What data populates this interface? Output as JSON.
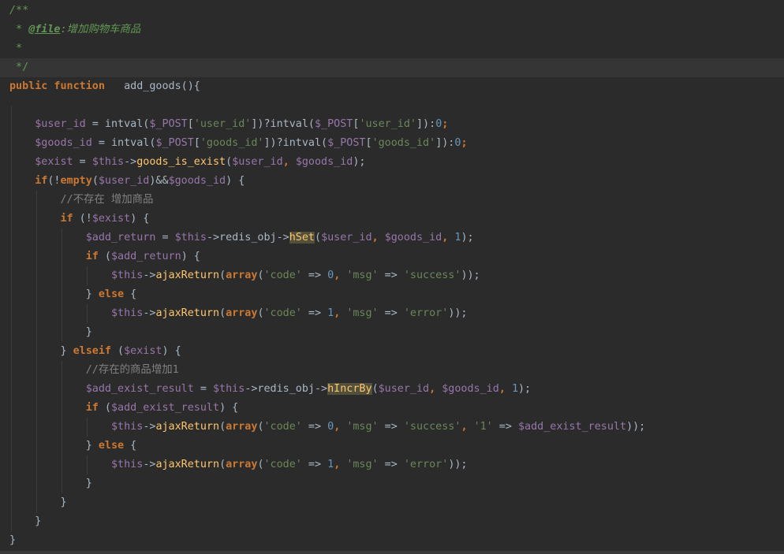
{
  "editor": {
    "lines": [
      [
        {
          "t": "/**",
          "c": "tk-comment"
        }
      ],
      [
        {
          "t": " * ",
          "c": "tk-docstar"
        },
        {
          "t": "@file",
          "c": "tk-doctag"
        },
        {
          "t": ":增加购物车商品",
          "c": "tk-comment"
        }
      ],
      [
        {
          "t": " *",
          "c": "tk-docstar"
        }
      ],
      [
        {
          "t": " */",
          "c": "tk-docstar"
        }
      ],
      [
        {
          "t": "public function",
          "c": "tk-keyword"
        },
        {
          "t": "   add_goods(){",
          "c": "tk-plain"
        }
      ],
      [],
      [
        {
          "t": "    ",
          "c": "tk-plain"
        },
        {
          "t": "$user_id",
          "c": "tk-var"
        },
        {
          "t": " = intval(",
          "c": "tk-plain"
        },
        {
          "t": "$_POST",
          "c": "tk-var"
        },
        {
          "t": "[",
          "c": "tk-plain"
        },
        {
          "t": "'user_id'",
          "c": "tk-string"
        },
        {
          "t": "])?intval(",
          "c": "tk-plain"
        },
        {
          "t": "$_POST",
          "c": "tk-var"
        },
        {
          "t": "[",
          "c": "tk-plain"
        },
        {
          "t": "'user_id'",
          "c": "tk-string"
        },
        {
          "t": "]):",
          "c": "tk-plain"
        },
        {
          "t": "0",
          "c": "tk-number"
        },
        {
          "t": ";",
          "c": "tk-keyword"
        }
      ],
      [
        {
          "t": "    ",
          "c": "tk-plain"
        },
        {
          "t": "$goods_id",
          "c": "tk-var"
        },
        {
          "t": " = intval(",
          "c": "tk-plain"
        },
        {
          "t": "$_POST",
          "c": "tk-var"
        },
        {
          "t": "[",
          "c": "tk-plain"
        },
        {
          "t": "'goods_id'",
          "c": "tk-string"
        },
        {
          "t": "])?intval(",
          "c": "tk-plain"
        },
        {
          "t": "$_POST",
          "c": "tk-var"
        },
        {
          "t": "[",
          "c": "tk-plain"
        },
        {
          "t": "'goods_id'",
          "c": "tk-string"
        },
        {
          "t": "]):",
          "c": "tk-plain"
        },
        {
          "t": "0",
          "c": "tk-number"
        },
        {
          "t": ";",
          "c": "tk-keyword"
        }
      ],
      [
        {
          "t": "    ",
          "c": "tk-plain"
        },
        {
          "t": "$exist",
          "c": "tk-var"
        },
        {
          "t": " = ",
          "c": "tk-plain"
        },
        {
          "t": "$this",
          "c": "tk-var"
        },
        {
          "t": "->",
          "c": "tk-plain"
        },
        {
          "t": "goods_is_exist",
          "c": "tk-fn"
        },
        {
          "t": "(",
          "c": "tk-plain"
        },
        {
          "t": "$user_id",
          "c": "tk-var"
        },
        {
          "t": ", ",
          "c": "tk-keyword"
        },
        {
          "t": "$goods_id",
          "c": "tk-var"
        },
        {
          "t": ");",
          "c": "tk-plain"
        }
      ],
      [
        {
          "t": "    ",
          "c": "tk-plain"
        },
        {
          "t": "if",
          "c": "tk-keyword"
        },
        {
          "t": "(!",
          "c": "tk-plain"
        },
        {
          "t": "empty",
          "c": "tk-keyword"
        },
        {
          "t": "(",
          "c": "tk-plain"
        },
        {
          "t": "$user_id",
          "c": "tk-var"
        },
        {
          "t": ")&&",
          "c": "tk-plain"
        },
        {
          "t": "$goods_id",
          "c": "tk-var"
        },
        {
          "t": ") {",
          "c": "tk-plain"
        }
      ],
      [
        {
          "t": "        ",
          "c": "tk-plain"
        },
        {
          "t": "//不存在 增加商品",
          "c": "tk-linecomment"
        }
      ],
      [
        {
          "t": "        ",
          "c": "tk-plain"
        },
        {
          "t": "if",
          "c": "tk-keyword"
        },
        {
          "t": " (!",
          "c": "tk-plain"
        },
        {
          "t": "$exist",
          "c": "tk-var"
        },
        {
          "t": ") {",
          "c": "tk-plain"
        }
      ],
      [
        {
          "t": "            ",
          "c": "tk-plain"
        },
        {
          "t": "$add_return",
          "c": "tk-var"
        },
        {
          "t": " = ",
          "c": "tk-plain"
        },
        {
          "t": "$this",
          "c": "tk-var"
        },
        {
          "t": "->redis_obj->",
          "c": "tk-plain"
        },
        {
          "t": "hSet",
          "c": "tk-fnhl"
        },
        {
          "t": "(",
          "c": "tk-plain"
        },
        {
          "t": "$user_id",
          "c": "tk-var"
        },
        {
          "t": ", ",
          "c": "tk-keyword"
        },
        {
          "t": "$goods_id",
          "c": "tk-var"
        },
        {
          "t": ", ",
          "c": "tk-keyword"
        },
        {
          "t": "1",
          "c": "tk-number"
        },
        {
          "t": ");",
          "c": "tk-plain"
        }
      ],
      [
        {
          "t": "            ",
          "c": "tk-plain"
        },
        {
          "t": "if",
          "c": "tk-keyword"
        },
        {
          "t": " (",
          "c": "tk-plain"
        },
        {
          "t": "$add_return",
          "c": "tk-var"
        },
        {
          "t": ") {",
          "c": "tk-plain"
        }
      ],
      [
        {
          "t": "                ",
          "c": "tk-plain"
        },
        {
          "t": "$this",
          "c": "tk-var"
        },
        {
          "t": "->",
          "c": "tk-plain"
        },
        {
          "t": "ajaxReturn",
          "c": "tk-fn"
        },
        {
          "t": "(",
          "c": "tk-plain"
        },
        {
          "t": "array",
          "c": "tk-keyword"
        },
        {
          "t": "(",
          "c": "tk-plain"
        },
        {
          "t": "'code'",
          "c": "tk-string"
        },
        {
          "t": " => ",
          "c": "tk-plain"
        },
        {
          "t": "0",
          "c": "tk-number"
        },
        {
          "t": ", ",
          "c": "tk-keyword"
        },
        {
          "t": "'msg'",
          "c": "tk-string"
        },
        {
          "t": " => ",
          "c": "tk-plain"
        },
        {
          "t": "'success'",
          "c": "tk-string"
        },
        {
          "t": "));",
          "c": "tk-plain"
        }
      ],
      [
        {
          "t": "            ",
          "c": "tk-plain"
        },
        {
          "t": "} ",
          "c": "tk-plain"
        },
        {
          "t": "else",
          "c": "tk-keyword"
        },
        {
          "t": " {",
          "c": "tk-plain"
        }
      ],
      [
        {
          "t": "                ",
          "c": "tk-plain"
        },
        {
          "t": "$this",
          "c": "tk-var"
        },
        {
          "t": "->",
          "c": "tk-plain"
        },
        {
          "t": "ajaxReturn",
          "c": "tk-fn"
        },
        {
          "t": "(",
          "c": "tk-plain"
        },
        {
          "t": "array",
          "c": "tk-keyword"
        },
        {
          "t": "(",
          "c": "tk-plain"
        },
        {
          "t": "'code'",
          "c": "tk-string"
        },
        {
          "t": " => ",
          "c": "tk-plain"
        },
        {
          "t": "1",
          "c": "tk-number"
        },
        {
          "t": ", ",
          "c": "tk-keyword"
        },
        {
          "t": "'msg'",
          "c": "tk-string"
        },
        {
          "t": " => ",
          "c": "tk-plain"
        },
        {
          "t": "'error'",
          "c": "tk-string"
        },
        {
          "t": "));",
          "c": "tk-plain"
        }
      ],
      [
        {
          "t": "            }",
          "c": "tk-plain"
        }
      ],
      [
        {
          "t": "        ",
          "c": "tk-plain"
        },
        {
          "t": "} ",
          "c": "tk-plain"
        },
        {
          "t": "elseif",
          "c": "tk-keyword"
        },
        {
          "t": " (",
          "c": "tk-plain"
        },
        {
          "t": "$exist",
          "c": "tk-var"
        },
        {
          "t": ") {",
          "c": "tk-plain"
        }
      ],
      [
        {
          "t": "            ",
          "c": "tk-plain"
        },
        {
          "t": "//存在的商品增加1",
          "c": "tk-linecomment"
        }
      ],
      [
        {
          "t": "            ",
          "c": "tk-plain"
        },
        {
          "t": "$add_exist_result",
          "c": "tk-var"
        },
        {
          "t": " = ",
          "c": "tk-plain"
        },
        {
          "t": "$this",
          "c": "tk-var"
        },
        {
          "t": "->redis_obj->",
          "c": "tk-plain"
        },
        {
          "t": "hIncrBy",
          "c": "tk-fnhl"
        },
        {
          "t": "(",
          "c": "tk-plain"
        },
        {
          "t": "$user_id",
          "c": "tk-var"
        },
        {
          "t": ", ",
          "c": "tk-keyword"
        },
        {
          "t": "$goods_id",
          "c": "tk-var"
        },
        {
          "t": ", ",
          "c": "tk-keyword"
        },
        {
          "t": "1",
          "c": "tk-number"
        },
        {
          "t": ");",
          "c": "tk-plain"
        }
      ],
      [
        {
          "t": "            ",
          "c": "tk-plain"
        },
        {
          "t": "if",
          "c": "tk-keyword"
        },
        {
          "t": " (",
          "c": "tk-plain"
        },
        {
          "t": "$add_exist_result",
          "c": "tk-var"
        },
        {
          "t": ") {",
          "c": "tk-plain"
        }
      ],
      [
        {
          "t": "                ",
          "c": "tk-plain"
        },
        {
          "t": "$this",
          "c": "tk-var"
        },
        {
          "t": "->",
          "c": "tk-plain"
        },
        {
          "t": "ajaxReturn",
          "c": "tk-fn"
        },
        {
          "t": "(",
          "c": "tk-plain"
        },
        {
          "t": "array",
          "c": "tk-keyword"
        },
        {
          "t": "(",
          "c": "tk-plain"
        },
        {
          "t": "'code'",
          "c": "tk-string"
        },
        {
          "t": " => ",
          "c": "tk-plain"
        },
        {
          "t": "0",
          "c": "tk-number"
        },
        {
          "t": ", ",
          "c": "tk-keyword"
        },
        {
          "t": "'msg'",
          "c": "tk-string"
        },
        {
          "t": " => ",
          "c": "tk-plain"
        },
        {
          "t": "'success'",
          "c": "tk-string"
        },
        {
          "t": ", ",
          "c": "tk-keyword"
        },
        {
          "t": "'1'",
          "c": "tk-string"
        },
        {
          "t": " => ",
          "c": "tk-plain"
        },
        {
          "t": "$add_exist_result",
          "c": "tk-var"
        },
        {
          "t": "));",
          "c": "tk-plain"
        }
      ],
      [
        {
          "t": "            ",
          "c": "tk-plain"
        },
        {
          "t": "} ",
          "c": "tk-plain"
        },
        {
          "t": "else",
          "c": "tk-keyword"
        },
        {
          "t": " {",
          "c": "tk-plain"
        }
      ],
      [
        {
          "t": "                ",
          "c": "tk-plain"
        },
        {
          "t": "$this",
          "c": "tk-var"
        },
        {
          "t": "->",
          "c": "tk-plain"
        },
        {
          "t": "ajaxReturn",
          "c": "tk-fn"
        },
        {
          "t": "(",
          "c": "tk-plain"
        },
        {
          "t": "array",
          "c": "tk-keyword"
        },
        {
          "t": "(",
          "c": "tk-plain"
        },
        {
          "t": "'code'",
          "c": "tk-string"
        },
        {
          "t": " => ",
          "c": "tk-plain"
        },
        {
          "t": "1",
          "c": "tk-number"
        },
        {
          "t": ", ",
          "c": "tk-keyword"
        },
        {
          "t": "'msg'",
          "c": "tk-string"
        },
        {
          "t": " => ",
          "c": "tk-plain"
        },
        {
          "t": "'error'",
          "c": "tk-string"
        },
        {
          "t": "));",
          "c": "tk-plain"
        }
      ],
      [
        {
          "t": "            }",
          "c": "tk-plain"
        }
      ],
      [
        {
          "t": "        }",
          "c": "tk-plain"
        }
      ],
      [
        {
          "t": "    }",
          "c": "tk-plain"
        }
      ],
      [
        {
          "t": "}",
          "c": "tk-plain"
        }
      ]
    ],
    "highlighted_line": 3
  },
  "colors": {
    "background": "#2b2b2b",
    "current_line": "#353535",
    "keyword": "#cc7832",
    "variable": "#9876aa",
    "string": "#6a8759",
    "number": "#6897bb",
    "function": "#ffc66d",
    "plain": "#a9b7c6",
    "doc_comment": "#629755",
    "line_comment": "#808080"
  }
}
